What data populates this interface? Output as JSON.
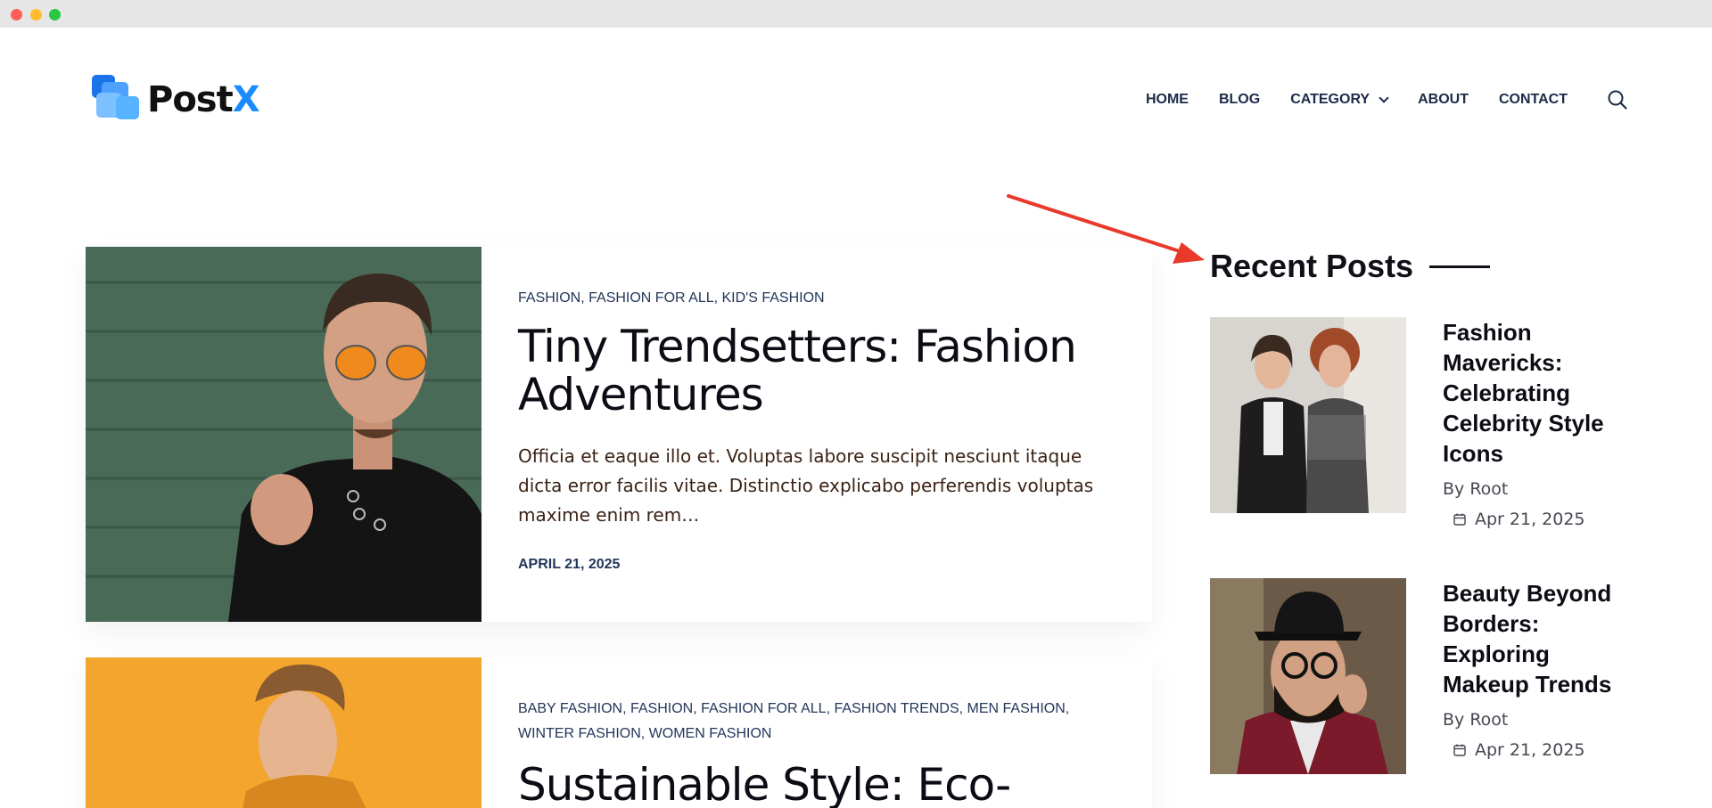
{
  "site": {
    "logo_main": "Post",
    "logo_accent": "X"
  },
  "nav": {
    "items": [
      {
        "label": "HOME"
      },
      {
        "label": "BLOG"
      },
      {
        "label": "CATEGORY"
      },
      {
        "label": "ABOUT"
      },
      {
        "label": "CONTACT"
      }
    ],
    "search_icon": "search-icon"
  },
  "posts": [
    {
      "categories": "FASHION, FASHION FOR ALL, KID'S FASHION",
      "title": "Tiny Trendsetters: Fashion Adventures",
      "excerpt": "Officia et eaque illo et. Voluptas labore suscipit nesciunt itaque dicta error facilis vitae. Distinctio explicabo perferendis voluptas maxime enim rem…",
      "date": "APRIL 21, 2025"
    },
    {
      "categories": "BABY FASHION, FASHION, FASHION FOR ALL, FASHION TRENDS, MEN FASHION, WINTER FASHION, WOMEN FASHION",
      "title": "Sustainable Style: Eco-"
    }
  ],
  "sidebar": {
    "title": "Recent Posts",
    "posts": [
      {
        "title": "Fashion Mavericks: Celebrating Celebrity Style Icons",
        "author": "By Root",
        "date": "Apr 21, 2025"
      },
      {
        "title": "Beauty Beyond Borders: Exploring Makeup Trends",
        "author": "By Root",
        "date": "Apr 21, 2025"
      }
    ]
  },
  "colors": {
    "brand_blue": "#1a8cff",
    "nav_text": "#1d2a48",
    "annotation_arrow": "#e8392b"
  }
}
